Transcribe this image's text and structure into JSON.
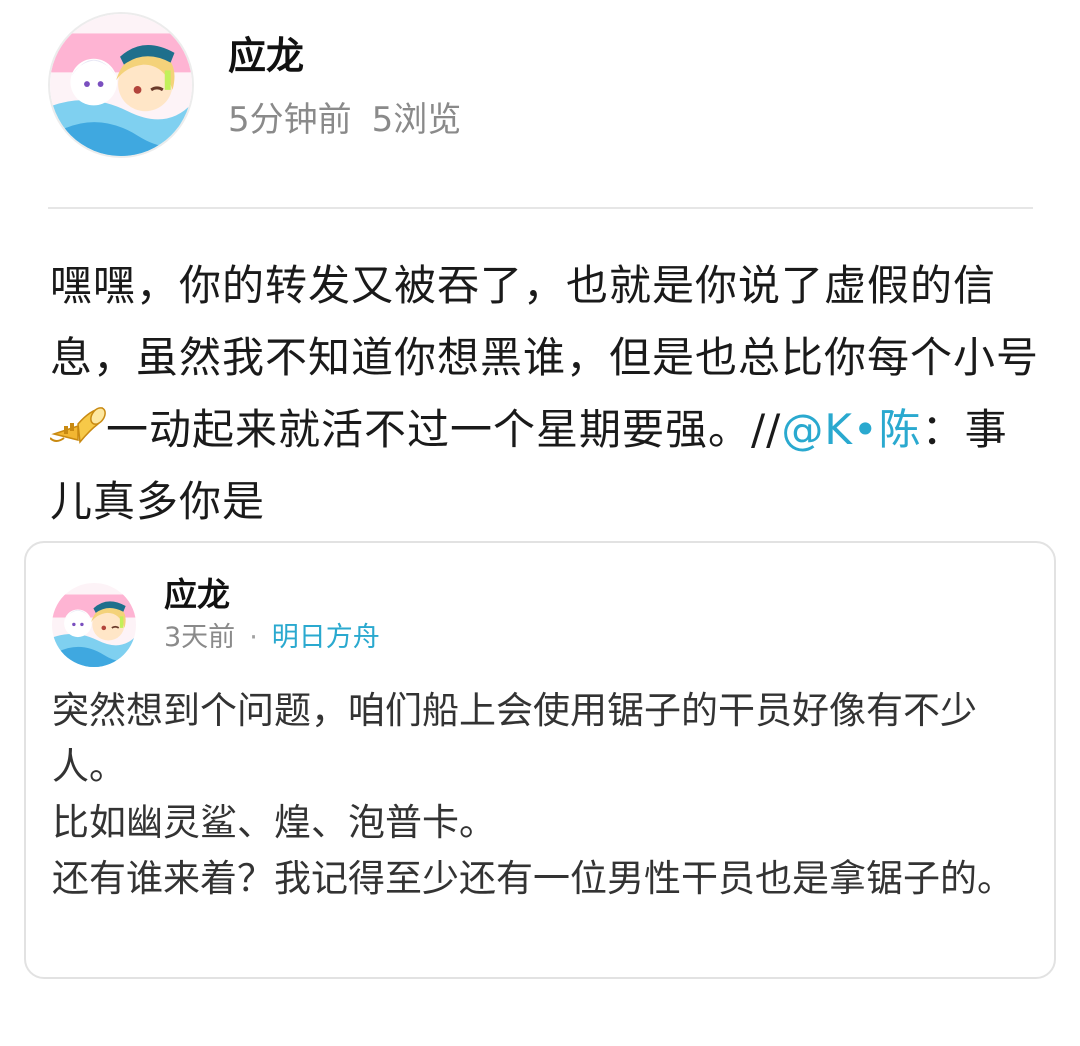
{
  "post": {
    "author": "应龙",
    "time": "5分钟前",
    "views": "5浏览",
    "body_before_emoji": "嘿嘿，你的转发又被吞了，也就是你说了虚假的信息，虽然我不知道你想黑谁，但是也总比你每个小号",
    "emoji": "trumpet-icon",
    "body_after_emoji": "一动起来就活不过一个星期要强。//",
    "mention": "@K•陈",
    "mention_suffix": "：事儿真多你是"
  },
  "quoted": {
    "author": "应龙",
    "time": "3天前",
    "separator": "·",
    "topic": "明日方舟",
    "text": "突然想到个问题，咱们船上会使用锯子的干员好像有不少人。\n比如幽灵鲨、煌、泡普卡。\n还有谁来着？我记得至少还有一位男性干员也是拿锯子的。"
  },
  "colors": {
    "mention": "#2aa9cf",
    "meta": "#8a8a8a"
  }
}
